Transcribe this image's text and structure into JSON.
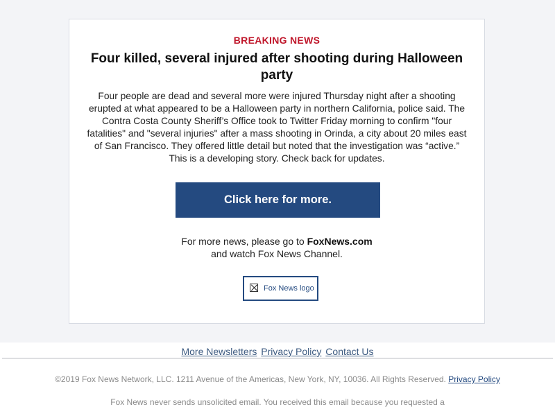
{
  "article": {
    "eyebrow": "BREAKING NEWS",
    "headline": "Four killed, several injured after shooting during Halloween party",
    "body": "Four people are dead and several more were injured Thursday night after a shooting erupted at what appeared to be a Halloween party in northern California, police said.  The Contra Costa County Sheriff’s Office took to Twitter Friday morning to confirm \"four fatalities\" and \"several injuries\" after a mass shooting in Orinda, a city about 20 miles east of San Francisco. They offered little detail but noted that the investigation was “active.” This is a developing story. Check back for updates.",
    "cta_label": "Click here for more."
  },
  "more_news": {
    "prefix": "For more news, please go to ",
    "site": "FoxNews.com",
    "suffix": "and watch Fox News Channel."
  },
  "logo": {
    "alt": "Fox News logo",
    "icon": "broken-image-icon"
  },
  "footer": {
    "links": [
      "More Newsletters",
      "Privacy Policy",
      "Contact Us"
    ],
    "copyright": "©2019 Fox News Network, LLC. 1211 Avenue of the Americas, New York, NY, 10036. All Rights Reserved.",
    "copyright_link": "Privacy Policy",
    "disclaimer": "Fox News never sends unsolicited email. You received this email because you requested a"
  },
  "colors": {
    "accent_red": "#c0172b",
    "brand_blue": "#244a80",
    "background": "#f3f4f7"
  }
}
